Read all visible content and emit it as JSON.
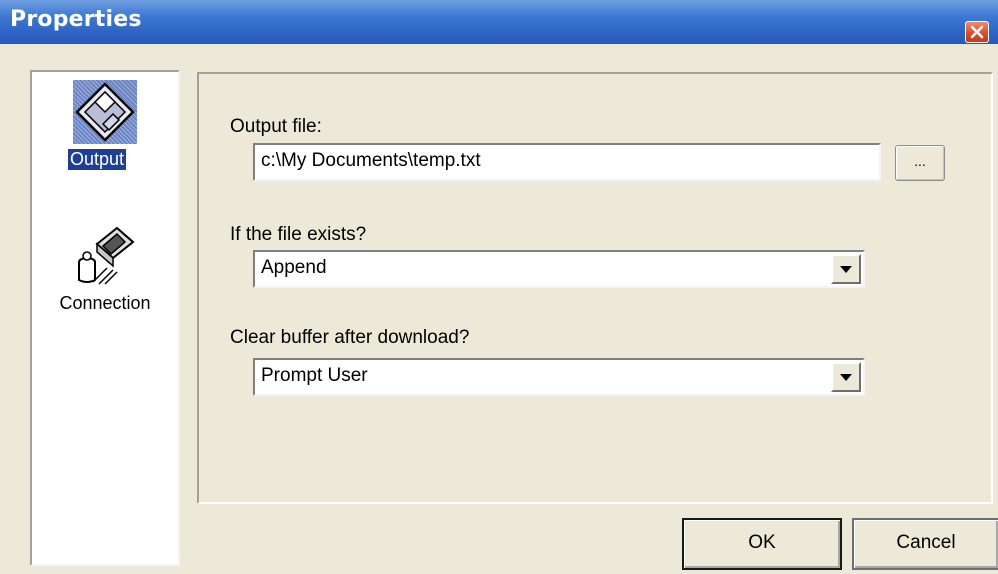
{
  "window": {
    "title": "Properties"
  },
  "sidebar": {
    "items": [
      {
        "label": "Output",
        "icon": "floppy-disk-icon",
        "selected": true
      },
      {
        "label": "Connection",
        "icon": "modem-phone-icon",
        "selected": false
      }
    ]
  },
  "output": {
    "file_label": "Output file:",
    "file_value": "c:\\My Documents\\temp.txt",
    "browse_label": "...",
    "exists_label": "If the file exists?",
    "exists_value": "Append",
    "clear_label": "Clear buffer after download?",
    "clear_value": "Prompt User"
  },
  "buttons": {
    "ok": "OK",
    "cancel": "Cancel"
  },
  "colors": {
    "titlebar": "#2e64c4",
    "selection": "#1f3f93",
    "close": "#d64b2c",
    "face": "#ece9d8"
  }
}
